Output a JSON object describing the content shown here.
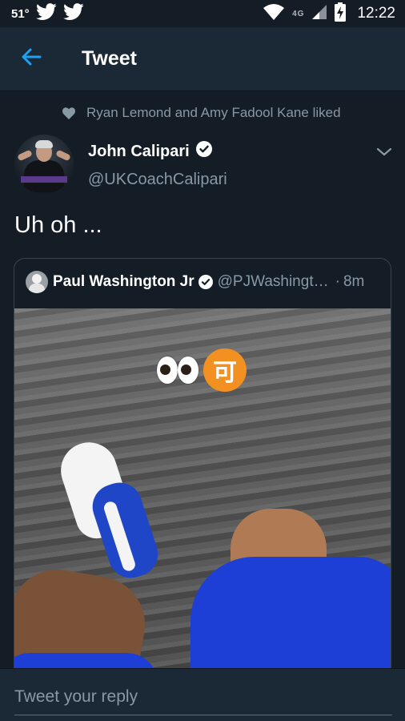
{
  "status_bar": {
    "temperature": "51°",
    "network": "4G",
    "time": "12:22",
    "icons": [
      "twitter-icon",
      "twitter-icon",
      "wifi-icon",
      "signal-icon",
      "battery-charging-icon"
    ]
  },
  "app_bar": {
    "title": "Tweet",
    "back_icon": "arrow-left-icon"
  },
  "social_context": {
    "text": "Ryan Lemond and Amy Fadool Kane liked",
    "icon": "heart-icon"
  },
  "author": {
    "name": "John Calipari",
    "handle": "@UKCoachCalipari",
    "verified": true
  },
  "tweet": {
    "text": "Uh oh ..."
  },
  "quoted_tweet": {
    "name": "Paul Washington Jr",
    "handle": "@PJWashingt…",
    "dot": "·",
    "time": "8m",
    "verified": true,
    "overlay_kanji": "可"
  },
  "reply": {
    "placeholder": "Tweet your reply"
  },
  "colors": {
    "background": "#141d26",
    "bar": "#1b2836",
    "accent": "#1da1f2",
    "secondary_text": "#8899a6",
    "border": "#38444d"
  }
}
